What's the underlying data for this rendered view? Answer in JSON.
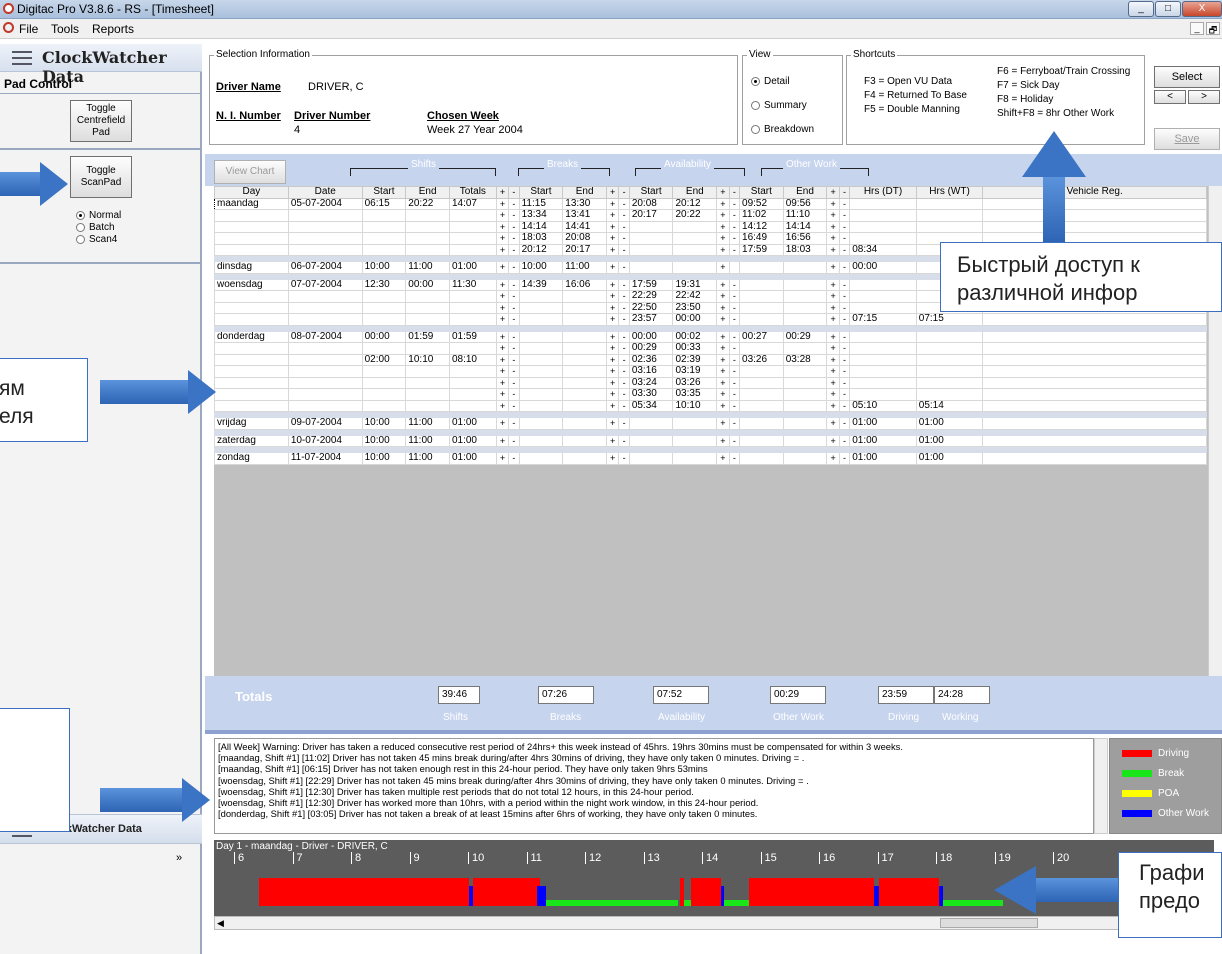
{
  "window": {
    "title": "Digitac Pro V3.8.6 - RS - [Timesheet]",
    "minimize": "_",
    "maximize": "□",
    "close": "X",
    "inner_restore": "_",
    "inner_max": "🗗"
  },
  "menu": [
    "File",
    "Tools",
    "Reports"
  ],
  "left": {
    "header": "ClockWatcher Data",
    "pad_control": "Pad Control",
    "toggle_centrefield": "Toggle Centrefield Pad",
    "toggle_scanpad": "Toggle ScanPad",
    "modes": [
      {
        "label": "Normal",
        "selected": true
      },
      {
        "label": "Batch",
        "selected": false
      },
      {
        "label": "Scan4",
        "selected": false
      }
    ],
    "footer": "ClockWatcher Data",
    "expand": "»"
  },
  "selection": {
    "group": "Selection Information",
    "driver_name_label": "Driver Name",
    "driver_name": "DRIVER, C",
    "ni_label": "N. I. Number",
    "driver_number_label": "Driver Number",
    "driver_number": "4",
    "chosen_week_label": "Chosen Week",
    "chosen_week": "Week 27 Year 2004"
  },
  "view": {
    "group": "View",
    "options": [
      {
        "label": "Detail",
        "selected": true
      },
      {
        "label": "Summary",
        "selected": false
      },
      {
        "label": "Breakdown",
        "selected": false
      }
    ]
  },
  "shortcuts": {
    "group": "Shortcuts",
    "col1": [
      "F3 = Open VU Data",
      "F4 = Returned To Base",
      "F5 = Double Manning"
    ],
    "col2": [
      "F6 = Ferryboat/Train Crossing",
      "F7 = Sick Day",
      "F8 = Holiday",
      "Shift+F8 = 8hr Other Work"
    ]
  },
  "actions": {
    "select": "Select",
    "prev": "<",
    "next": ">",
    "save": "Save"
  },
  "bands": {
    "view_chart": "View Chart",
    "shifts": "Shifts",
    "breaks": "Breaks",
    "availability": "Availability",
    "other_work": "Other Work"
  },
  "grid": {
    "headers": [
      "Day",
      "Date",
      "Start",
      "End",
      "Totals",
      "+",
      "-",
      "Start",
      "End",
      "+",
      "-",
      "Start",
      "End",
      "+",
      "-",
      "Start",
      "End",
      "+",
      "-",
      "Hrs (DT)",
      "Hrs (WT)",
      "Vehicle Reg."
    ],
    "rows": [
      [
        "maandag",
        "05-07-2004",
        "06:15",
        "20:22",
        "14:07",
        "+",
        "-",
        "11:15",
        "13:30",
        "+",
        "-",
        "20:08",
        "20:12",
        "+",
        "-",
        "09:52",
        "09:56",
        "+",
        "-",
        "",
        "",
        ""
      ],
      [
        "",
        "",
        "",
        "",
        "",
        "+",
        "-",
        "13:34",
        "13:41",
        "+",
        "-",
        "20:17",
        "20:22",
        "+",
        "-",
        "11:02",
        "11:10",
        "+",
        "-",
        "",
        "",
        ""
      ],
      [
        "",
        "",
        "",
        "",
        "",
        "+",
        "-",
        "14:14",
        "14:41",
        "+",
        "-",
        "",
        "",
        "+",
        "-",
        "14:12",
        "14:14",
        "+",
        "-",
        "",
        "",
        ""
      ],
      [
        "",
        "",
        "",
        "",
        "",
        "+",
        "-",
        "18:03",
        "20:08",
        "+",
        "-",
        "",
        "",
        "+",
        "-",
        "16:49",
        "16:56",
        "+",
        "-",
        "",
        "",
        ""
      ],
      [
        "",
        "",
        "",
        "",
        "",
        "+",
        "-",
        "20:12",
        "20:17",
        "+",
        "-",
        "",
        "",
        "+",
        "-",
        "17:59",
        "18:03",
        "+",
        "-",
        "08:34",
        "",
        ""
      ],
      "gap",
      [
        "dinsdag",
        "06-07-2004",
        "10:00",
        "11:00",
        "01:00",
        "+",
        "-",
        "10:00",
        "11:00",
        "+",
        "-",
        "",
        "",
        "+",
        "",
        "",
        "",
        "+",
        "-",
        "00:00",
        "",
        ""
      ],
      "gap",
      [
        "woensdag",
        "07-07-2004",
        "12:30",
        "00:00",
        "11:30",
        "+",
        "-",
        "14:39",
        "16:06",
        "+",
        "-",
        "17:59",
        "19:31",
        "+",
        "-",
        "",
        "",
        "+",
        "-",
        "",
        "",
        ""
      ],
      [
        "",
        "",
        "",
        "",
        "",
        "+",
        "-",
        "",
        "",
        "+",
        "-",
        "22:29",
        "22:42",
        "+",
        "-",
        "",
        "",
        "+",
        "-",
        "",
        "",
        ""
      ],
      [
        "",
        "",
        "",
        "",
        "",
        "+",
        "-",
        "",
        "",
        "+",
        "-",
        "22:50",
        "23:50",
        "+",
        "-",
        "",
        "",
        "+",
        "-",
        "",
        "",
        ""
      ],
      [
        "",
        "",
        "",
        "",
        "",
        "+",
        "-",
        "",
        "",
        "+",
        "-",
        "23:57",
        "00:00",
        "+",
        "-",
        "",
        "",
        "+",
        "-",
        "07:15",
        "07:15",
        ""
      ],
      "gap",
      [
        "donderdag",
        "08-07-2004",
        "00:00",
        "01:59",
        "01:59",
        "+",
        "-",
        "",
        "",
        "+",
        "-",
        "00:00",
        "00:02",
        "+",
        "-",
        "00:27",
        "00:29",
        "+",
        "-",
        "",
        "",
        ""
      ],
      [
        "",
        "",
        "",
        "",
        "",
        "+",
        "-",
        "",
        "",
        "+",
        "-",
        "00:29",
        "00:33",
        "+",
        "-",
        "",
        "",
        "+",
        "-",
        "",
        "",
        ""
      ],
      [
        "",
        "",
        "02:00",
        "10:10",
        "08:10",
        "+",
        "-",
        "",
        "",
        "+",
        "-",
        "02:36",
        "02:39",
        "+",
        "-",
        "03:26",
        "03:28",
        "+",
        "-",
        "",
        "",
        ""
      ],
      [
        "",
        "",
        "",
        "",
        "",
        "+",
        "-",
        "",
        "",
        "+",
        "-",
        "03:16",
        "03:19",
        "+",
        "-",
        "",
        "",
        "+",
        "-",
        "",
        "",
        ""
      ],
      [
        "",
        "",
        "",
        "",
        "",
        "+",
        "-",
        "",
        "",
        "+",
        "-",
        "03:24",
        "03:26",
        "+",
        "-",
        "",
        "",
        "+",
        "-",
        "",
        "",
        ""
      ],
      [
        "",
        "",
        "",
        "",
        "",
        "+",
        "-",
        "",
        "",
        "+",
        "-",
        "03:30",
        "03:35",
        "+",
        "-",
        "",
        "",
        "+",
        "-",
        "",
        "",
        ""
      ],
      [
        "",
        "",
        "",
        "",
        "",
        "+",
        "-",
        "",
        "",
        "+",
        "-",
        "05:34",
        "10:10",
        "+",
        "-",
        "",
        "",
        "+",
        "-",
        "05:10",
        "05:14",
        ""
      ],
      "gap",
      [
        "vrijdag",
        "09-07-2004",
        "10:00",
        "11:00",
        "01:00",
        "+",
        "-",
        "",
        "",
        "+",
        "-",
        "",
        "",
        "+",
        "-",
        "",
        "",
        "+",
        "-",
        "01:00",
        "01:00",
        ""
      ],
      "gap",
      [
        "zaterdag",
        "10-07-2004",
        "10:00",
        "11:00",
        "01:00",
        "+",
        "-",
        "",
        "",
        "+",
        "-",
        "",
        "",
        "+",
        "-",
        "",
        "",
        "+",
        "-",
        "01:00",
        "01:00",
        ""
      ],
      "gap",
      [
        "zondag",
        "11-07-2004",
        "10:00",
        "11:00",
        "01:00",
        "+",
        "-",
        "",
        "",
        "+",
        "-",
        "",
        "",
        "+",
        "-",
        "",
        "",
        "+",
        "-",
        "01:00",
        "01:00",
        ""
      ]
    ]
  },
  "totals": {
    "label": "Totals",
    "shifts": "39:46",
    "shifts_cap": "Shifts",
    "breaks": "07:26",
    "breaks_cap": "Breaks",
    "availability": "07:52",
    "availability_cap": "Availability",
    "other_work": "00:29",
    "other_cap": "Other Work",
    "driving": "23:59",
    "driving_cap": "Driving",
    "working": "24:28",
    "working_cap": "Working"
  },
  "messages": [
    "[All Week] Warning: Driver has taken a reduced consecutive rest period of 24hrs+ this week instead of 45hrs. 19hrs 30mins must be compensated for within 3 weeks.",
    "[maandag, Shift #1] [11:02] Driver has not taken 45 mins break during/after 4hrs 30mins of driving, they have only taken 0 minutes. Driving = .",
    "[maandag, Shift #1] [06:15] Driver has not taken enough rest in this 24-hour period. They have only taken 9hrs 53mins",
    "[woensdag, Shift #1] [22:29] Driver has not taken 45 mins break during/after 4hrs 30mins of driving, they have only taken 0 minutes. Driving = .",
    "[woensdag, Shift #1] [12:30] Driver has taken multiple rest periods that do not total 12 hours, in this 24-hour period.",
    "[woensdag, Shift #1] [12:30] Driver has worked more than 10hrs, with a period within the night work window, in this 24-hour period.",
    "[donderdag, Shift #1] [03:05] Driver has not taken a break of at least 15mins after 6hrs of working, they have only taken 0 minutes."
  ],
  "legend": [
    {
      "label": "Driving",
      "color": "#ff0000"
    },
    {
      "label": "Break",
      "color": "#19e619"
    },
    {
      "label": "POA",
      "color": "#ffff00"
    },
    {
      "label": "Other Work",
      "color": "#0000ff"
    }
  ],
  "timeline": {
    "title": "Day 1 - maandag - Driver - DRIVER, C",
    "hours": [
      "6",
      "7",
      "8",
      "9",
      "10",
      "11",
      "12",
      "13",
      "14",
      "15",
      "16",
      "17",
      "18",
      "19",
      "20"
    ]
  },
  "callouts": {
    "shortcuts_text": [
      "Быстрый доступ к",
      "различной инфор"
    ],
    "left_middle_text": [
      "ям",
      "еля"
    ],
    "chart_text": [
      "Графи",
      "предо"
    ]
  }
}
